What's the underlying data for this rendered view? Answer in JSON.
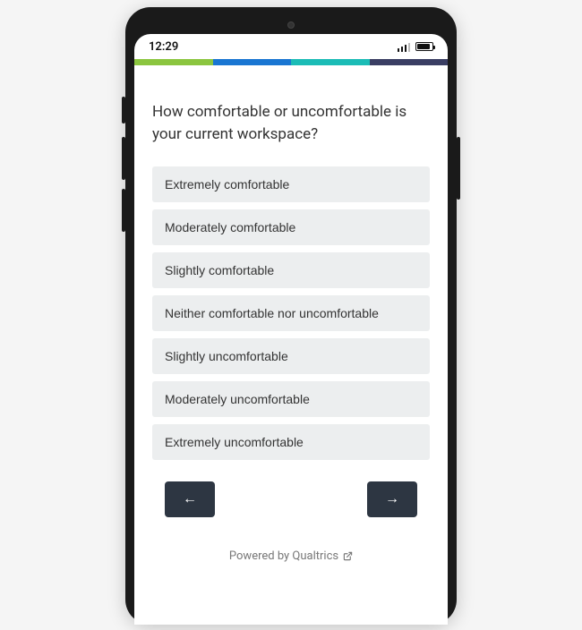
{
  "status": {
    "time": "12:29"
  },
  "progress": {
    "segments": [
      {
        "color": "#8bc53f"
      },
      {
        "color": "#1976d2"
      },
      {
        "color": "#1bbcb6"
      },
      {
        "color": "#3a3e63"
      }
    ]
  },
  "question": "How comfortable or uncomfortable is your current workspace?",
  "options": [
    "Extremely comfortable",
    "Moderately comfortable",
    "Slightly comfortable",
    "Neither comfortable nor uncomfortable",
    "Slightly uncomfortable",
    "Moderately uncomfortable",
    "Extremely uncomfortable"
  ],
  "nav": {
    "back_glyph": "←",
    "next_glyph": "→"
  },
  "footer": {
    "powered_label": "Powered by Qualtrics"
  }
}
